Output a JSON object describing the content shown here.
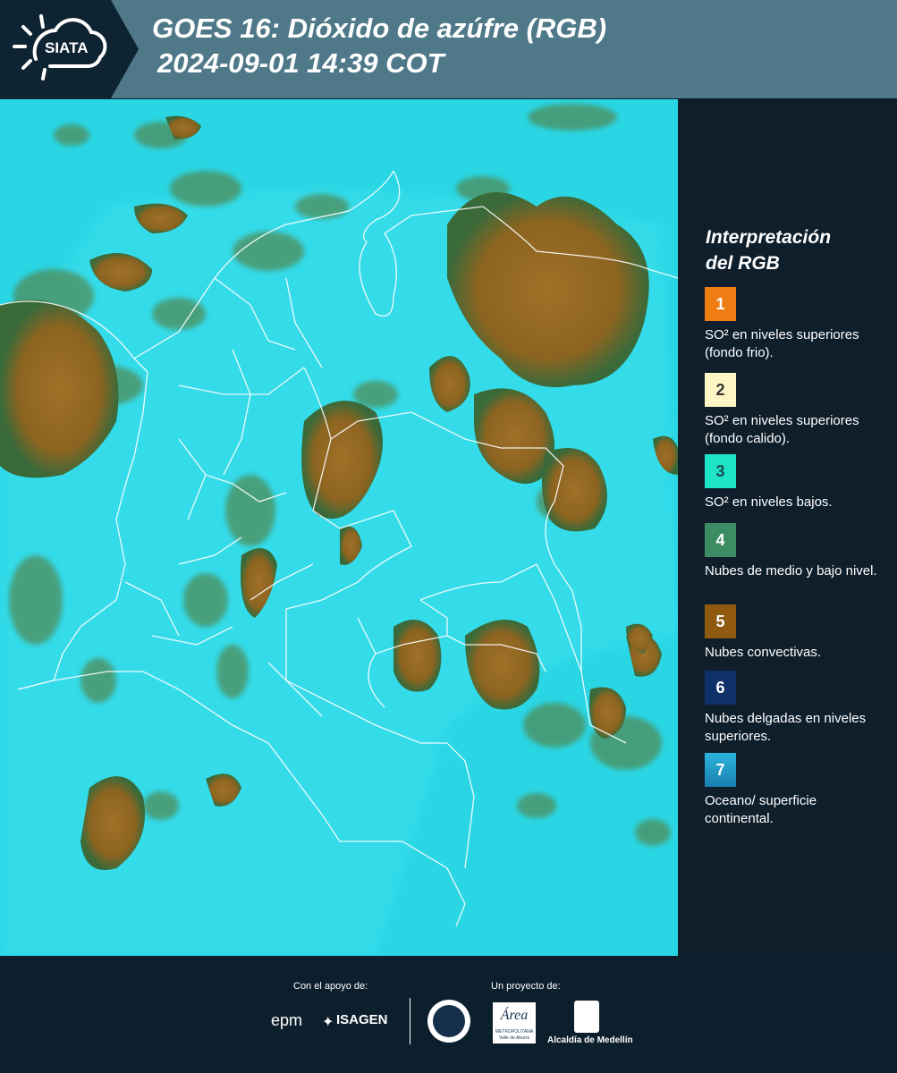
{
  "header": {
    "logo_text": "SIATA",
    "title_line1": "GOES 16: Dióxido de azúfre (RGB)",
    "title_line2": "2024-09-01 14:39 COT"
  },
  "legend": {
    "title_line1": "Interpretación",
    "title_line2": "del RGB",
    "items": [
      {
        "number": "1",
        "text": "SO² en niveles superiores (fondo frio).",
        "color": "#f07d14"
      },
      {
        "number": "2",
        "text": "SO² en niveles superiores (fondo calido).",
        "color": "#fdf5c4"
      },
      {
        "number": "3",
        "text": "SO² en niveles bajos.",
        "color": "#1ee5c8"
      },
      {
        "number": "4",
        "text": "Nubes de medio y bajo nivel.",
        "color": "#3c8c64"
      },
      {
        "number": "5",
        "text": "Nubes convectivas.",
        "color": "#8f5a10"
      },
      {
        "number": "6",
        "text": "Nubes delgadas en niveles superiores.",
        "color": "#10306a"
      },
      {
        "number": "7",
        "text": "Oceano/ superficie continental.",
        "color": "#1e92be"
      }
    ]
  },
  "footer": {
    "support_label": "Con el apoyo de:",
    "project_label": "Un proyecto de:",
    "sponsor_epm": "epm",
    "sponsor_isagen": "ISAGEN",
    "sponsor_area_metropolitana": "Área",
    "area_metropolitana_sub1": "METROPOLITANA",
    "area_metropolitana_sub2": "Valle de Aburrá",
    "sponsor_alcaldia": "Alcaldía de Medellín"
  },
  "colors": {
    "header_bg": "#4f7888",
    "logo_bg": "#0f2432",
    "legend_bg": "#0e1e2b",
    "footer_bg": "#0c1f2c",
    "ocean_cyan": "#2cd8e6",
    "convective_cloud": "#9a6a22"
  }
}
